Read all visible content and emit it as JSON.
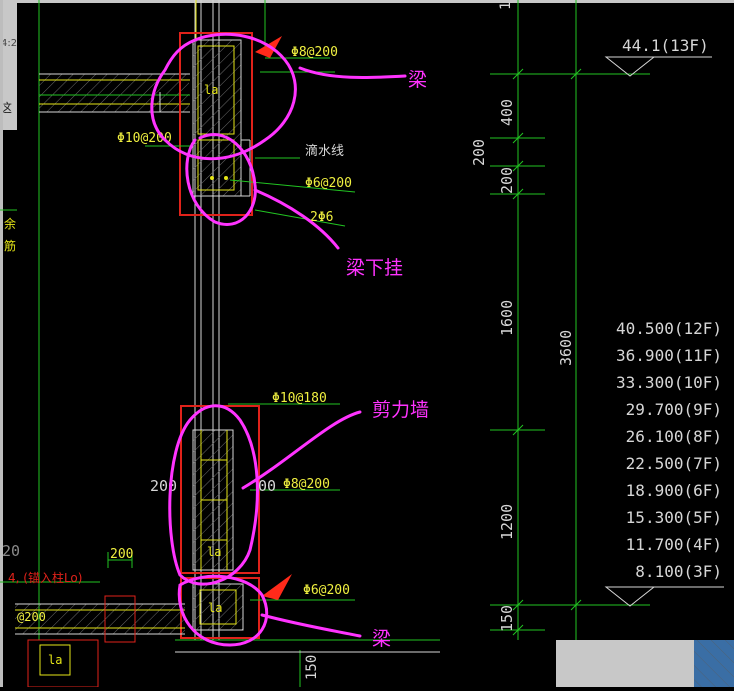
{
  "window": {
    "frame_color": "#c8c8c8",
    "thumb_color": "#3a6ea5"
  },
  "colors": {
    "line_green": "#22c422",
    "line_white": "#d6d6d6",
    "rebar_yellow": "#e6e617",
    "hatch_gray": "#8a8a8a",
    "box_red": "#e0221a",
    "annot_magenta": "#ff33ff",
    "text_white": "#e8e8e8",
    "text_yellow": "#f0f040",
    "arrow_red": "#ff2a1a"
  },
  "left_fragments": {
    "time": "4:2",
    "char": "这"
  },
  "rebar_labels": {
    "top_stirrup": "Φ8@200",
    "left_stirrup": "Φ10@200",
    "drip_line": "滴水线",
    "hanger_stirrup": "Φ6@200",
    "hanger_bars": "2Φ6",
    "wall_vertical": "Φ10@180",
    "wall_horizontal": "Φ8@200",
    "bottom_stirrup": "Φ6@200",
    "left_small": "@200",
    "left_side": "4, (锚入柱Lo)",
    "left_200": "200"
  },
  "dim_labels": {
    "wall_200_left": "200",
    "wall_200_right": "00",
    "beam_la_top": "la",
    "beam_la_bottom": "la",
    "beam_la_left": "la",
    "wall_la": "la",
    "left_20": "20",
    "left_yu": "余",
    "left_zhen": "筋"
  },
  "annotations": {
    "beam_top": "梁",
    "beam_hanger": "梁下挂",
    "shear_wall": "剪力墙",
    "beam_bottom": "梁"
  },
  "elevation_dims": {
    "top_one": "1",
    "d400": "400",
    "d200a": "200",
    "d200b": "200",
    "d1600": "1600",
    "d3600": "3600",
    "d1200": "1200",
    "d150": "150",
    "d150_bottom": "150"
  },
  "floor_levels": {
    "top": "44.1(13F)",
    "list": [
      "40.500(12F)",
      "36.900(11F)",
      "33.300(10F)",
      "29.700(9F)",
      "26.100(8F)",
      "22.500(7F)",
      "18.900(6F)",
      "15.300(5F)",
      "11.700(4F)",
      "8.100(3F)"
    ]
  }
}
